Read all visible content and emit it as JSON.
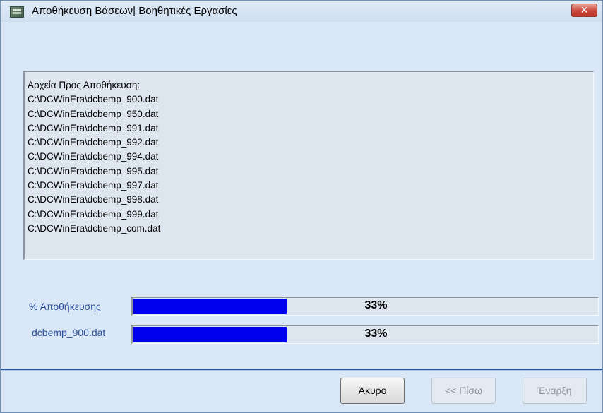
{
  "window": {
    "title": "Αποθήκευση Βάσεων| Βοηθητικές Εργασίες",
    "close_label": "✕"
  },
  "file_list": {
    "header": "Αρχεία Προς Αποθήκευση:",
    "files": [
      "C:\\DCWinEra\\dcbemp_900.dat",
      "C:\\DCWinEra\\dcbemp_950.dat",
      "C:\\DCWinEra\\dcbemp_991.dat",
      "C:\\DCWinEra\\dcbemp_992.dat",
      "C:\\DCWinEra\\dcbemp_994.dat",
      "C:\\DCWinEra\\dcbemp_995.dat",
      "C:\\DCWinEra\\dcbemp_997.dat",
      "C:\\DCWinEra\\dcbemp_998.dat",
      "C:\\DCWinEra\\dcbemp_999.dat",
      "C:\\DCWinEra\\dcbemp_com.dat"
    ]
  },
  "progress": {
    "overall": {
      "label": "% Αποθήκευσης",
      "percent": 33,
      "text": "33%"
    },
    "file": {
      "label": "dcbemp_900.dat",
      "percent": 33,
      "text": "33%"
    }
  },
  "buttons": {
    "cancel": "Άκυρο",
    "back": "<< Πίσω",
    "start": "Έναρξη"
  },
  "colors": {
    "progress_fill": "#0000ee",
    "label_text": "#2a4e9a",
    "window_bg": "#d9e7f6"
  }
}
